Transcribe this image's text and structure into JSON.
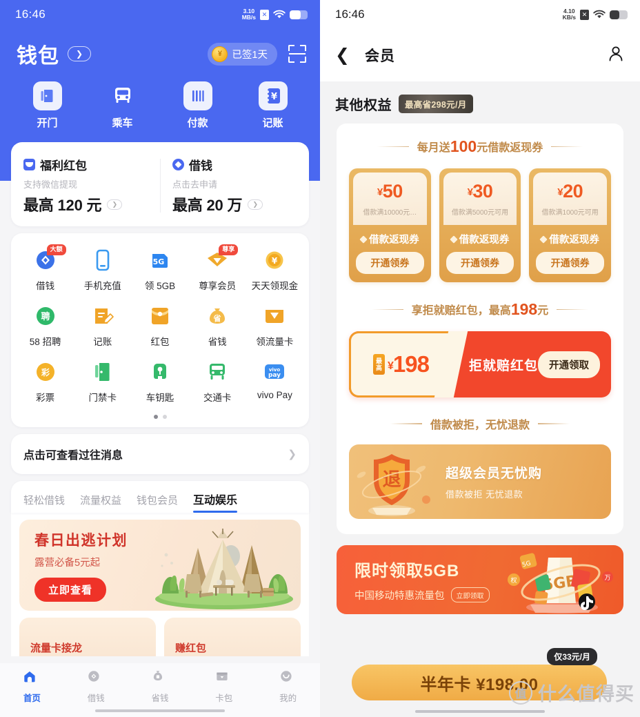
{
  "left": {
    "status_bar": {
      "time": "16:46",
      "net_speed_value": "3.10",
      "net_speed_unit": "MB/s",
      "sim_icon": "sim-card-icon",
      "wifi_icon": "wifi-icon",
      "battery_icon": "battery-icon"
    },
    "header": {
      "title": "钱包",
      "title_arrow_icon": "chevron-right-icon",
      "signin_label": "已签1天",
      "coin_icon": "coin-icon",
      "scan_icon": "scan-qr-icon",
      "bg_color": "#4a68f0"
    },
    "quick_actions": [
      {
        "label": "开门",
        "icon": "door-open-icon"
      },
      {
        "label": "乘车",
        "icon": "bus-icon"
      },
      {
        "label": "付款",
        "icon": "barcode-icon"
      },
      {
        "label": "记账",
        "icon": "ledger-yuan-icon"
      }
    ],
    "benefits": [
      {
        "icon": "red-packet-icon",
        "title": "福利红包",
        "sub": "支持微信提现",
        "amount": "最高 120 元",
        "arrow_icon": "chevron-right-icon"
      },
      {
        "icon": "loan-diamond-icon",
        "title": "借钱",
        "sub": "点击去申请",
        "amount": "最高 20 万",
        "arrow_icon": "chevron-right-icon"
      }
    ],
    "grid": [
      {
        "label": "借钱",
        "icon": "loan-diamond-icon",
        "tag": "大额",
        "color": "#3b72e8"
      },
      {
        "label": "手机充值",
        "icon": "phone-icon",
        "tag": "",
        "color": "#3b9af0"
      },
      {
        "label": "领 5GB",
        "icon": "sim-5g-icon",
        "tag": "",
        "color": "#2d86f0"
      },
      {
        "label": "尊享会员",
        "icon": "vip-gem-icon",
        "tag": "尊享",
        "color": "#f0a92c"
      },
      {
        "label": "天天领现金",
        "icon": "coin-yuan-icon",
        "tag": "",
        "color": "#f5bb36"
      },
      {
        "label": "58 招聘",
        "icon": "recruit-icon",
        "tag": "",
        "color": "#2fb96a"
      },
      {
        "label": "记账",
        "icon": "note-pencil-icon",
        "tag": "",
        "color": "#f0a428"
      },
      {
        "label": "红包",
        "icon": "red-envelope-icon",
        "tag": "",
        "color": "#f0a428"
      },
      {
        "label": "省钱",
        "icon": "money-bag-icon",
        "tag": "",
        "color": "#f4bb4a"
      },
      {
        "label": "领流量卡",
        "icon": "data-card-icon",
        "tag": "",
        "color": "#f0a428"
      },
      {
        "label": "彩票",
        "icon": "lottery-icon",
        "tag": "",
        "color": "#f4b229"
      },
      {
        "label": "门禁卡",
        "icon": "access-card-icon",
        "tag": "",
        "color": "#35b96b"
      },
      {
        "label": "车钥匙",
        "icon": "car-key-icon",
        "tag": "",
        "color": "#35b96b"
      },
      {
        "label": "交通卡",
        "icon": "transit-bus-icon",
        "tag": "",
        "color": "#35b96b"
      },
      {
        "label": "vivo Pay",
        "icon": "vivo-pay-icon",
        "tag": "",
        "color": "#3b8ef0"
      }
    ],
    "pager": {
      "total": 2,
      "active": 0
    },
    "message_row": {
      "text": "点击可查看过往消息",
      "arrow_icon": "chevron-right-icon"
    },
    "tabs": [
      {
        "label": "轻松借钱",
        "active": false
      },
      {
        "label": "流量权益",
        "active": false
      },
      {
        "label": "钱包会员",
        "active": false
      },
      {
        "label": "互动娱乐",
        "active": true
      }
    ],
    "promo": {
      "title": "春日出逃计划",
      "subtitle": "露营必备5元起",
      "button": "立即查看",
      "art_icon": "camping-tent-illustration"
    },
    "mini_cards": [
      {
        "text": "流量卡接龙"
      },
      {
        "text": "赚红包"
      }
    ],
    "bottom_nav": [
      {
        "label": "首页",
        "icon": "home-icon",
        "active": true
      },
      {
        "label": "借钱",
        "icon": "loan-diamond-icon",
        "active": false
      },
      {
        "label": "省钱",
        "icon": "money-bag-icon",
        "active": false
      },
      {
        "label": "卡包",
        "icon": "card-wallet-icon",
        "active": false
      },
      {
        "label": "我的",
        "icon": "profile-smile-icon",
        "active": false
      }
    ]
  },
  "right": {
    "status_bar": {
      "time": "16:46",
      "net_speed_value": "4.10",
      "net_speed_unit": "KB/s",
      "sim_icon": "sim-card-icon",
      "wifi_icon": "wifi-icon",
      "battery_icon": "battery-icon"
    },
    "navbar": {
      "back_icon": "back-chevron-icon",
      "title": "会员",
      "profile_icon": "person-icon"
    },
    "section": {
      "title": "其他权益",
      "badge": "最高省298元/月"
    },
    "coupon_block": {
      "heading_prefix": "每月送",
      "heading_amount": "100",
      "heading_suffix": "元借款返现券",
      "coupons": [
        {
          "yen": "¥",
          "amount": "50",
          "condition": "借款满10000元…",
          "type": "借款返现券",
          "button": "开通领券",
          "diamond_icon": "diamond-icon"
        },
        {
          "yen": "¥",
          "amount": "30",
          "condition": "借款满5000元可用",
          "type": "借款返现券",
          "button": "开通领券",
          "diamond_icon": "diamond-icon"
        },
        {
          "yen": "¥",
          "amount": "20",
          "condition": "借款满1000元可用",
          "type": "借款返现券",
          "button": "开通领券",
          "diamond_icon": "diamond-icon"
        }
      ]
    },
    "redbag_block": {
      "heading_prefix": "享拒就赔红包，最高",
      "heading_amount": "198",
      "heading_suffix": "元",
      "tag_vertical": "最高",
      "yen": "¥",
      "amount": "198",
      "title": "拒就赔红包",
      "button": "开通领取"
    },
    "shield_block": {
      "heading": "借款被拒，无忧退款",
      "shield_char": "退",
      "title": "超级会员无忧购",
      "subtitle": "借款被拒 无忧退款",
      "art_icon": "refund-shield-illustration"
    },
    "gb_banner": {
      "title": "限时领取5GB",
      "subtitle": "中国移动特惠流量包",
      "pill": "立即领取",
      "art_icon": "data-pack-illustration"
    },
    "buy_bar": {
      "label": "半年卡 ¥198.00",
      "tip": "仅33元/月"
    },
    "watermark": {
      "logo_char": "值",
      "text": "什么值得买"
    }
  },
  "colors": {
    "brand_blue": "#4a68f0",
    "accent_orange": "#ef5a22",
    "accent_gold": "#eab965",
    "accent_red": "#f2472c",
    "tab_active_blue": "#2f6bed"
  }
}
